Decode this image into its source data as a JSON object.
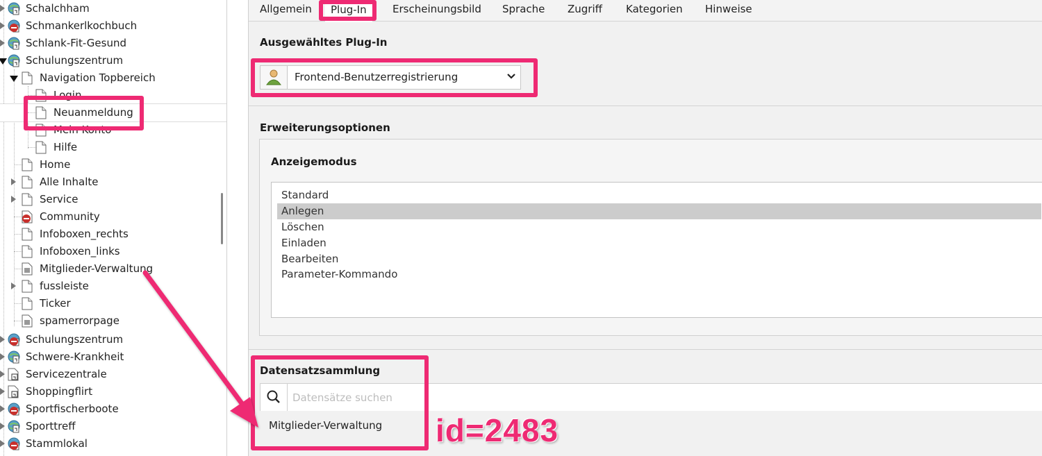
{
  "tree": {
    "items": [
      {
        "label": "Schalchham",
        "icon": "globe-page-icon",
        "status": "active"
      },
      {
        "label": "Schmankerlkochbuch",
        "icon": "globe-page-disabled-icon",
        "status": "disabled"
      },
      {
        "label": "Schlank-Fit-Gesund",
        "icon": "globe-page-icon",
        "status": "active"
      },
      {
        "label": "Schulungszentrum",
        "icon": "globe-page-icon",
        "status": "active"
      },
      {
        "label": "Navigation Topbereich",
        "icon": "page-icon"
      },
      {
        "label": "Login",
        "icon": "page-icon"
      },
      {
        "label": "Neuanmeldung",
        "icon": "page-icon"
      },
      {
        "label": "Mein Konto",
        "icon": "page-icon"
      },
      {
        "label": "Hilfe",
        "icon": "page-icon"
      },
      {
        "label": "Home",
        "icon": "page-icon"
      },
      {
        "label": "Alle Inhalte",
        "icon": "page-icon"
      },
      {
        "label": "Service",
        "icon": "page-icon"
      },
      {
        "label": "Community",
        "icon": "page-disabled-icon"
      },
      {
        "label": "Infoboxen_rechts",
        "icon": "page-icon"
      },
      {
        "label": "Infoboxen_links",
        "icon": "page-icon"
      },
      {
        "label": "Mitglieder-Verwaltung",
        "icon": "folder-page-icon"
      },
      {
        "label": "fussleiste",
        "icon": "page-icon"
      },
      {
        "label": "Ticker",
        "icon": "page-icon"
      },
      {
        "label": "spamerrorpage",
        "icon": "folder-page-icon"
      },
      {
        "label": "Schulungszentrum",
        "icon": "globe-page-disabled-icon"
      },
      {
        "label": "Schwere-Krankheit",
        "icon": "globe-page-icon"
      },
      {
        "label": "Servicezentrale",
        "icon": "link-page-icon"
      },
      {
        "label": "Shoppingflirt",
        "icon": "link-page-icon"
      },
      {
        "label": "Sportfischerboote",
        "icon": "globe-page-disabled-icon"
      },
      {
        "label": "Sporttreff",
        "icon": "globe-page-icon"
      },
      {
        "label": "Stammlokal",
        "icon": "globe-page-disabled-icon"
      }
    ]
  },
  "tabs": [
    "Allgemein",
    "Plug-In",
    "Erscheinungsbild",
    "Sprache",
    "Zugriff",
    "Kategorien",
    "Hinweise"
  ],
  "active_tab": "Plug-In",
  "plugin": {
    "title": "Ausgewähltes Plug-In",
    "selected": "Frontend-Benutzerregistrierung"
  },
  "extension": {
    "title": "Erweiterungsoptionen",
    "mode_title": "Anzeigemodus",
    "options": [
      "Standard",
      "Anlegen",
      "Löschen",
      "Einladen",
      "Bearbeiten",
      "Parameter-Kommando"
    ],
    "selected_option": "Anlegen"
  },
  "records": {
    "title": "Datensatzsammlung",
    "search_placeholder": "Datensätze suchen",
    "items": [
      "Mitglieder-Verwaltung"
    ]
  },
  "annotation": {
    "id_label": "id=2483",
    "color": "#ee2a73"
  },
  "colors": {
    "highlight": "#ee2a73",
    "selected_option_bg": "#cccccc",
    "panel_bg": "#f1f1f1"
  }
}
